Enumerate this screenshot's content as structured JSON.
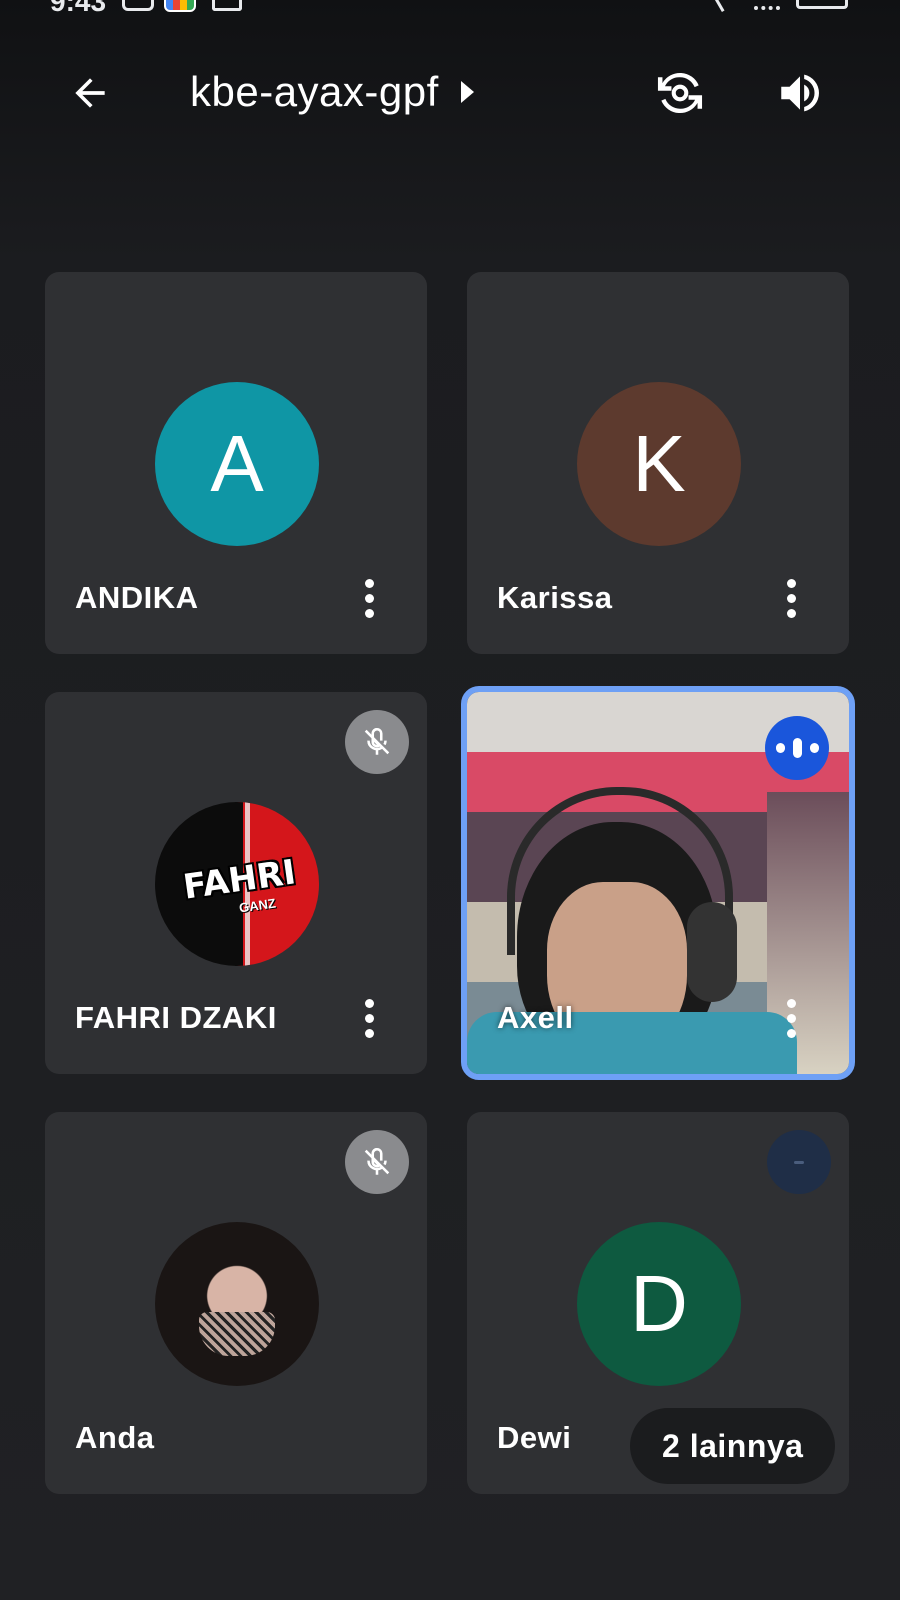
{
  "status_bar": {
    "time": "9:43"
  },
  "header": {
    "meeting_code": "kbe-ayax-gpf",
    "icons": [
      "back-arrow-icon",
      "chevron-right-icon",
      "switch-camera-icon",
      "speaker-icon"
    ]
  },
  "participants": [
    {
      "name": "ANDIKA",
      "initial": "A",
      "avatar_color": "#0f96a5",
      "muted": false
    },
    {
      "name": "Karissa",
      "initial": "K",
      "avatar_color": "#5d3a2e",
      "muted": false
    },
    {
      "name": "FAHRI DZAKI",
      "avatar_image_text": "FAHRI",
      "avatar_image_subtext": "GANZ",
      "muted": true
    },
    {
      "name": "Axell",
      "video_on": true,
      "speaking": true
    },
    {
      "name": "Anda",
      "muted": true
    },
    {
      "name": "Dewi",
      "initial": "D",
      "avatar_color": "#0e5a40",
      "muted": false
    }
  ],
  "others_label": "2 lainnya",
  "colors": {
    "background": "#202124",
    "tile": "#2f3033",
    "active_speaker_outline": "#6ea0f5",
    "speaking_badge": "#1a56db",
    "mute_badge": "#8a8b8e"
  }
}
